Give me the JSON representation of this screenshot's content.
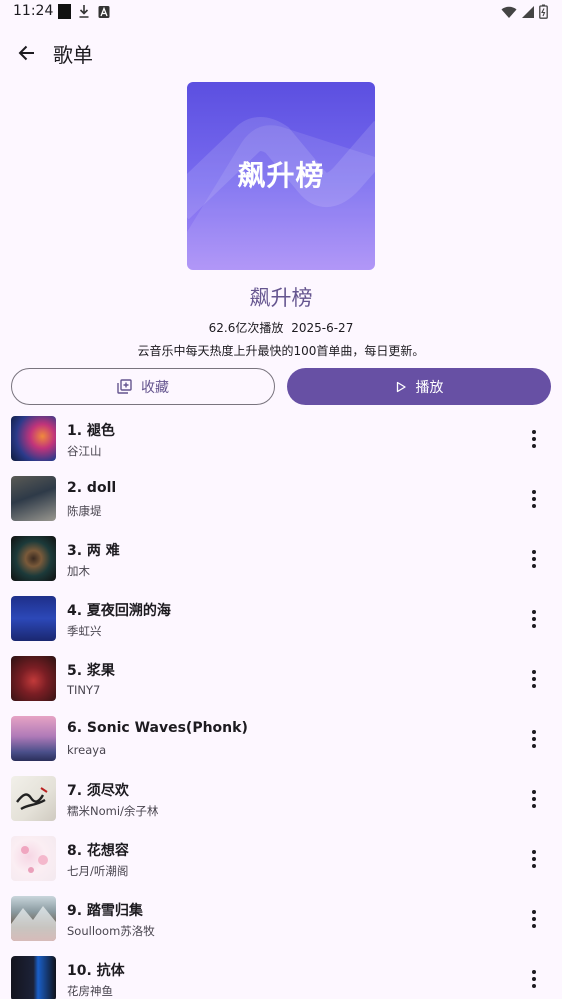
{
  "status_bar": {
    "time": "11:24",
    "left_icons": [
      "notification-square-icon",
      "download-icon",
      "a-badge-icon"
    ],
    "right_icons": [
      "wifi-icon",
      "signal-icon",
      "battery-icon"
    ]
  },
  "app_bar": {
    "title": "歌单",
    "back_icon": "arrow-left-icon"
  },
  "playlist": {
    "cover_text": "飙升榜",
    "title": "飙升榜",
    "play_count": "62.6亿次播放",
    "date": "2025-6-27",
    "description": "云音乐中每天热度上升最快的100首单曲，每日更新。"
  },
  "actions": {
    "collect_label": "收藏",
    "play_label": "播放"
  },
  "colors": {
    "accent": "#6750a4",
    "accent_text": "#65558f",
    "background": "#fdf7ff"
  },
  "songs": [
    {
      "title": "1. 褪色",
      "artist": "谷江山"
    },
    {
      "title": "2. doll",
      "artist": "陈康堤"
    },
    {
      "title": "3. 两 难",
      "artist": "加木"
    },
    {
      "title": "4. 夏夜回溯的海",
      "artist": "季虹兴"
    },
    {
      "title": "5. 浆果",
      "artist": "TINY7"
    },
    {
      "title": "6. Sonic Waves(Phonk)",
      "artist": "kreaya"
    },
    {
      "title": "7. 须尽欢",
      "artist": "糯米Nomi/余子林"
    },
    {
      "title": "8. 花想容",
      "artist": "七月/听潮阁"
    },
    {
      "title": "9. 踏雪归集",
      "artist": "Soulloom苏洛牧"
    },
    {
      "title": "10. 抗体",
      "artist": "花房神鱼"
    }
  ]
}
